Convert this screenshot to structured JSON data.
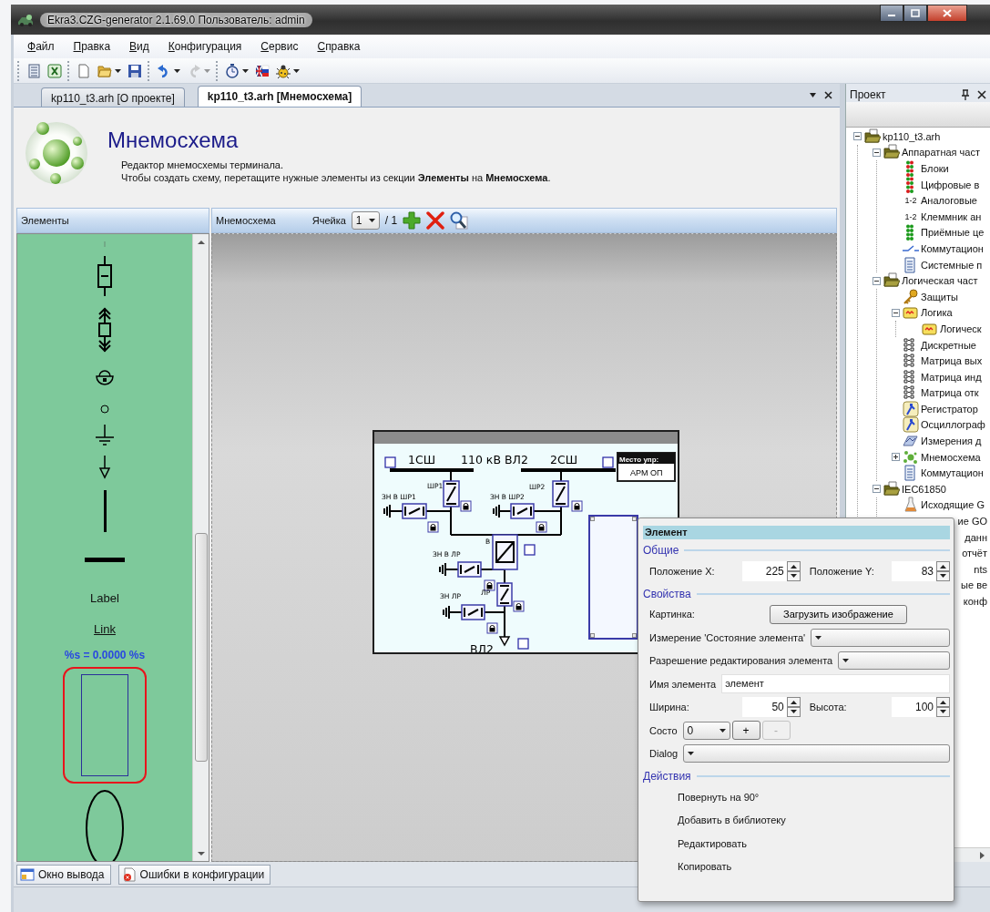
{
  "window": {
    "title": "Ekra3.CZG-generator 2.1.69.0 Пользователь: admin"
  },
  "menu": [
    "Файл",
    "Правка",
    "Вид",
    "Конфигурация",
    "Сервис",
    "Справка"
  ],
  "toolbar": [
    [
      {
        "kind": "notebook",
        "disabled": false,
        "has_menu": false
      },
      {
        "kind": "excel",
        "disabled": false,
        "has_menu": false
      }
    ],
    [
      {
        "kind": "new",
        "disabled": false,
        "has_menu": false
      },
      {
        "kind": "open",
        "disabled": false,
        "has_menu": true
      },
      {
        "kind": "save",
        "disabled": false,
        "has_menu": false
      }
    ],
    [
      {
        "kind": "undo",
        "disabled": false,
        "has_menu": true
      },
      {
        "kind": "redo",
        "disabled": true,
        "has_menu": true
      }
    ],
    [
      {
        "kind": "timer",
        "disabled": false,
        "has_menu": true
      },
      {
        "kind": "flag",
        "disabled": false,
        "has_menu": false
      },
      {
        "kind": "bug",
        "disabled": false,
        "has_menu": true
      }
    ]
  ],
  "doc_tabs": [
    {
      "label": "kp110_t3.arh [О проекте]",
      "selected": false
    },
    {
      "label": "kp110_t3.arh [Мнемосхема]",
      "selected": true
    }
  ],
  "header": {
    "title": "Мнемосхема",
    "lines": [
      "Редактор мнемосхемы терминала.",
      "Чтобы создать схему, перетащите нужные элементы из секции **Элементы** на **Мнемосхема**."
    ]
  },
  "elements_panel": {
    "title": "Элементы",
    "items": [
      {
        "kind": "stub",
        "selected": false
      },
      {
        "kind": "fuse",
        "selected": false
      },
      {
        "kind": "cart",
        "selected": false
      },
      {
        "kind": "lock",
        "selected": false
      },
      {
        "kind": "circle",
        "selected": false
      },
      {
        "kind": "ground",
        "selected": false
      },
      {
        "kind": "load",
        "selected": false
      },
      {
        "kind": "vline",
        "selected": false
      },
      {
        "kind": "hline",
        "selected": false
      },
      {
        "kind": "label",
        "text": "Label",
        "selected": false
      },
      {
        "kind": "link",
        "text": "Link",
        "selected": false
      },
      {
        "kind": "value",
        "text": "%s = 0.0000 %s",
        "selected": false
      },
      {
        "kind": "rect",
        "selected": true
      },
      {
        "kind": "ellipse",
        "selected": false
      }
    ]
  },
  "scheme_panel": {
    "title": "Мнемосхема",
    "cell_label": "Ячейка",
    "cell_value": "1",
    "cell_total": "/ 1"
  },
  "schematic": {
    "labels": [
      {
        "text": "1СШ",
        "kind": "large"
      },
      {
        "text": "110 кВ ВЛ2",
        "kind": "large"
      },
      {
        "text": "2СШ",
        "kind": "large"
      },
      {
        "text": "ШР1",
        "kind": "small"
      },
      {
        "text": "ЗН В ШР1",
        "kind": "small"
      },
      {
        "text": "ШР2",
        "kind": "small"
      },
      {
        "text": "ЗН В ШР2",
        "kind": "small"
      },
      {
        "text": "В",
        "kind": "small"
      },
      {
        "text": "ЗН В ЛР",
        "kind": "small"
      },
      {
        "text": "ЛР",
        "kind": "small"
      },
      {
        "text": "ЗН ЛР",
        "kind": "small"
      },
      {
        "text": "ВЛ2",
        "kind": "large"
      }
    ],
    "control_place": {
      "title": "Место упр:",
      "value": "АРМ ОП"
    }
  },
  "element_dialog": {
    "title": "Элемент",
    "sections": [
      {
        "title": "Общие",
        "rows": [
          {
            "kind": "spin_pair",
            "label": "Положение X:",
            "value": "225",
            "label2": "Положение Y:",
            "value2": "83"
          }
        ]
      },
      {
        "title": "Свойства",
        "rows": [
          {
            "kind": "button",
            "label": "Картинка:",
            "button": "Загрузить изображение"
          },
          {
            "kind": "select",
            "label": "Измерение 'Состояние элемента'"
          },
          {
            "kind": "select",
            "label": "Разрешение редактирования элемента"
          },
          {
            "kind": "text",
            "label": "Имя элемента",
            "value": "элемент"
          },
          {
            "kind": "spin_pair",
            "label": "Ширина:",
            "value": "50",
            "label2": "Высота:",
            "value2": "100"
          },
          {
            "kind": "state",
            "label": "Состо",
            "value": "0",
            "add": "+",
            "remove": "-",
            "add_disabled": false,
            "remove_disabled": true
          },
          {
            "kind": "select",
            "label": "Dialog"
          }
        ]
      },
      {
        "title": "Действия",
        "rows": [
          {
            "kind": "action",
            "label": "Повернуть на 90°"
          },
          {
            "kind": "action",
            "label": "Добавить в библиотеку"
          },
          {
            "kind": "action",
            "label": "Редактировать"
          },
          {
            "kind": "action",
            "label": "Копировать"
          }
        ]
      }
    ]
  },
  "project": {
    "title": "Проект",
    "tree": [
      {
        "label": "kp110_t3.arh",
        "kind": "folder",
        "expanded": true,
        "children": [
          {
            "label": "Аппаратная част",
            "kind": "folder",
            "expanded": true,
            "children": [
              {
                "label": "Блоки",
                "kind": "leds_red"
              },
              {
                "label": "Цифровые в",
                "kind": "leds_red"
              },
              {
                "label": "Аналоговые",
                "kind": "numbers",
                "badge": "1-2"
              },
              {
                "label": "Клеммник ан",
                "kind": "numbers",
                "badge": "1-2"
              },
              {
                "label": "Приёмные це",
                "kind": "leds_green"
              },
              {
                "label": "Коммутацион",
                "kind": "switch"
              },
              {
                "label": "Системные п",
                "kind": "document"
              }
            ]
          },
          {
            "label": "Логическая част",
            "kind": "folder",
            "expanded": true,
            "children": [
              {
                "label": "Защиты",
                "kind": "key"
              },
              {
                "label": "Логика",
                "kind": "logic",
                "expanded": true,
                "children": [
                  {
                    "label": "Логическ",
                    "kind": "logic"
                  }
                ]
              },
              {
                "label": "Дискретные",
                "kind": "matrix"
              },
              {
                "label": "Матрица вых",
                "kind": "matrix"
              },
              {
                "label": "Матрица инд",
                "kind": "matrix"
              },
              {
                "label": "Матрица отк",
                "kind": "matrix"
              },
              {
                "label": "Регистратор",
                "kind": "recorder"
              },
              {
                "label": "Осциллограф",
                "kind": "recorder"
              },
              {
                "label": "Измерения д",
                "kind": "measure"
              },
              {
                "label": "Мнемосхема",
                "kind": "mnemo",
                "expanded": false
              },
              {
                "label": "Коммутацион",
                "kind": "document"
              }
            ]
          },
          {
            "label": "IEC61850",
            "kind": "folder",
            "expanded": true,
            "children": [
              {
                "label": "Исходящие G",
                "kind": "goose"
              },
              {
                "label": "ие GO",
                "kind": "fragment"
              },
              {
                "label": "данн",
                "kind": "fragment"
              },
              {
                "label": "отчёт",
                "kind": "fragment"
              },
              {
                "label": "nts",
                "kind": "fragment"
              },
              {
                "label": "ые ве",
                "kind": "fragment"
              },
              {
                "label": "конф",
                "kind": "fragment"
              }
            ]
          }
        ]
      }
    ]
  },
  "bottom_tabs": [
    {
      "label": "Окно вывода",
      "kind": "output"
    },
    {
      "label": "Ошибки в конфигурации",
      "kind": "errors"
    }
  ]
}
